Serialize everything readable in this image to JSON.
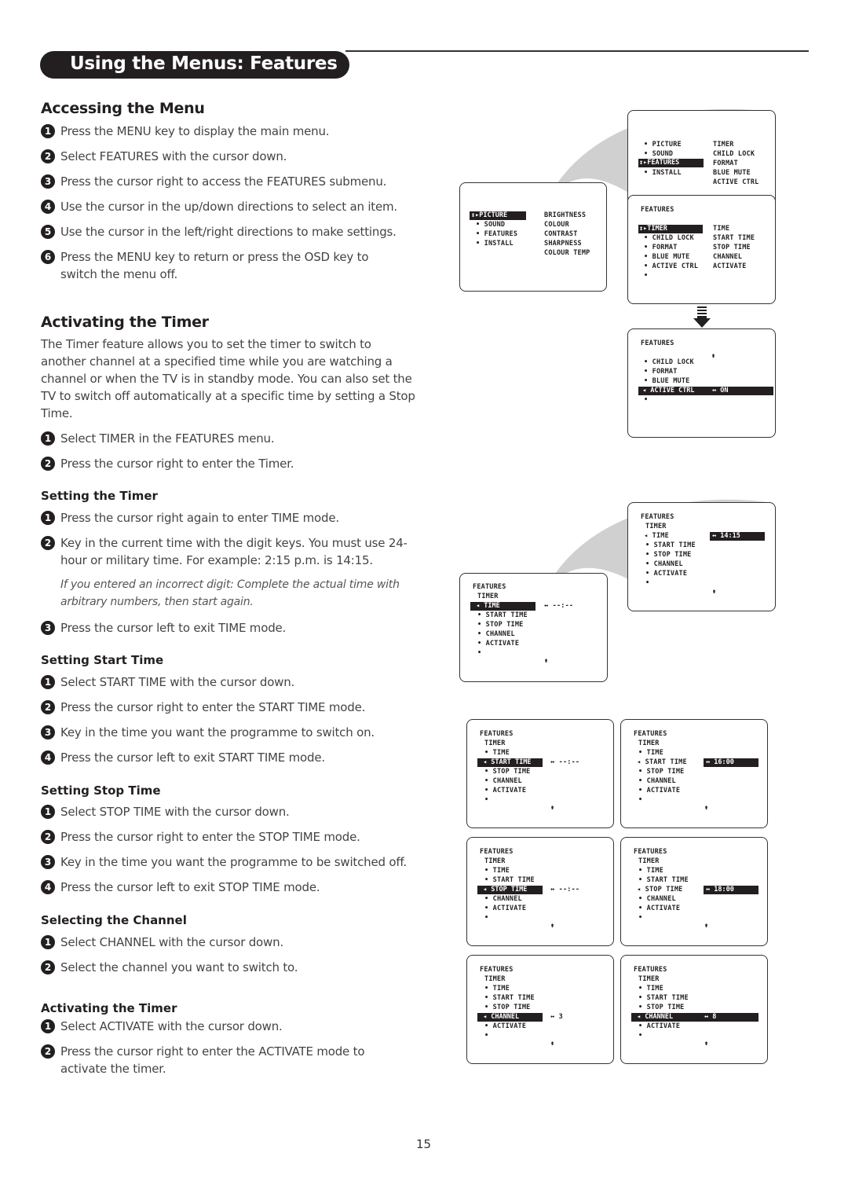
{
  "page": {
    "title": "Using the Menus: Features",
    "page_number": "15"
  },
  "accessing": {
    "heading": "Accessing the Menu",
    "steps": [
      {
        "num": "1",
        "text": "Press the MENU key to display the main menu."
      },
      {
        "num": "2",
        "text": "Select FEATURES with the cursor down."
      },
      {
        "num": "3",
        "text": "Press the cursor right to access the FEATURES submenu."
      },
      {
        "num": "4",
        "text": "Use the cursor in the up/down directions to select an item."
      },
      {
        "num": "5",
        "text": "Use the cursor in the left/right directions to make settings."
      },
      {
        "num": "6",
        "text": "Press the MENU key to return or press the OSD key to switch the menu off."
      }
    ]
  },
  "activating": {
    "heading": "Activating the Timer",
    "intro": "The Timer feature allows you to set the timer to switch to another channel at a specified time while you are watching a channel or when the TV is in standby mode. You can also set the TV to switch off automatically at a specific time by setting a Stop Time.",
    "steps": [
      {
        "num": "1",
        "text": "Select TIMER in the FEATURES menu."
      },
      {
        "num": "2",
        "text": "Press the cursor right to enter the Timer."
      }
    ]
  },
  "setting_timer": {
    "heading": "Setting the Timer",
    "steps": [
      {
        "num": "1",
        "text": "Press the cursor right again to enter TIME mode."
      },
      {
        "num": "2",
        "text": "Key in the current time with the digit keys. You must use 24-hour or military time. For example: 2:15 p.m. is 14:15."
      },
      {
        "num": "3",
        "text": "Press the cursor left to exit TIME mode."
      }
    ],
    "note": "If you entered an incorrect digit: Complete the actual time with arbitrary numbers, then start again."
  },
  "start_time": {
    "heading": "Setting Start Time",
    "steps": [
      {
        "num": "1",
        "text": "Select START TIME with the cursor down."
      },
      {
        "num": "2",
        "text": "Press the cursor right to enter the START TIME mode."
      },
      {
        "num": "3",
        "text": "Key in the time you want the programme to switch on."
      },
      {
        "num": "4",
        "text": "Press the cursor left to exit START TIME mode."
      }
    ]
  },
  "stop_time": {
    "heading": "Setting Stop Time",
    "steps": [
      {
        "num": "1",
        "text": "Select STOP TIME with the cursor down."
      },
      {
        "num": "2",
        "text": "Press the cursor right to enter the STOP TIME mode."
      },
      {
        "num": "3",
        "text": "Key in the time you want the programme to be switched off."
      },
      {
        "num": "4",
        "text": "Press the cursor left to exit STOP TIME mode."
      }
    ]
  },
  "channel": {
    "heading": "Selecting the Channel",
    "steps": [
      {
        "num": "1",
        "text": "Select CHANNEL with the cursor down."
      },
      {
        "num": "2",
        "text": "Select the channel you want to switch to."
      }
    ]
  },
  "activate": {
    "heading": "Activating the Timer",
    "steps": [
      {
        "num": "1",
        "text": "Select ACTIVATE with the cursor down."
      },
      {
        "num": "2",
        "text": "Press the cursor right to enter the ACTIVATE mode to activate the timer."
      }
    ]
  },
  "screens": {
    "main_menu": {
      "selected": "PICTURE",
      "items": [
        "SOUND",
        "FEATURES",
        "INSTALL"
      ],
      "submenu": [
        "BRIGHTNESS",
        "COLOUR",
        "CONTRAST",
        "SHARPNESS",
        "COLOUR TEMP"
      ]
    },
    "features_menu": {
      "items": [
        "PICTURE",
        "SOUND",
        "INSTALL"
      ],
      "selected": "FEATURES",
      "submenu": [
        "TIMER",
        "CHILD LOCK",
        "FORMAT",
        "BLUE MUTE",
        "ACTIVE CTRL"
      ]
    },
    "features_sub": {
      "title": "FEATURES",
      "selected": "TIMER",
      "items": [
        "CHILD LOCK",
        "FORMAT",
        "BLUE MUTE",
        "ACTIVE CTRL"
      ],
      "submenu": [
        "TIME",
        "START TIME",
        "STOP TIME",
        "CHANNEL",
        "ACTIVATE"
      ]
    },
    "active_ctrl": {
      "title": "FEATURES",
      "items": [
        "CHILD LOCK",
        "FORMAT",
        "BLUE MUTE"
      ],
      "selected": "ACTIVE CTRL",
      "value": "ON"
    },
    "timer_menu": {
      "title": "FEATURES",
      "subtitle": "TIMER",
      "items": [
        "TIME",
        "START TIME",
        "STOP TIME",
        "CHANNEL",
        "ACTIVATE"
      ],
      "empty_time": "--:--",
      "time_value": "14:15",
      "start_value": "16:00",
      "stop_value": "18:00",
      "channel_a": "3",
      "channel_b": "8"
    }
  }
}
